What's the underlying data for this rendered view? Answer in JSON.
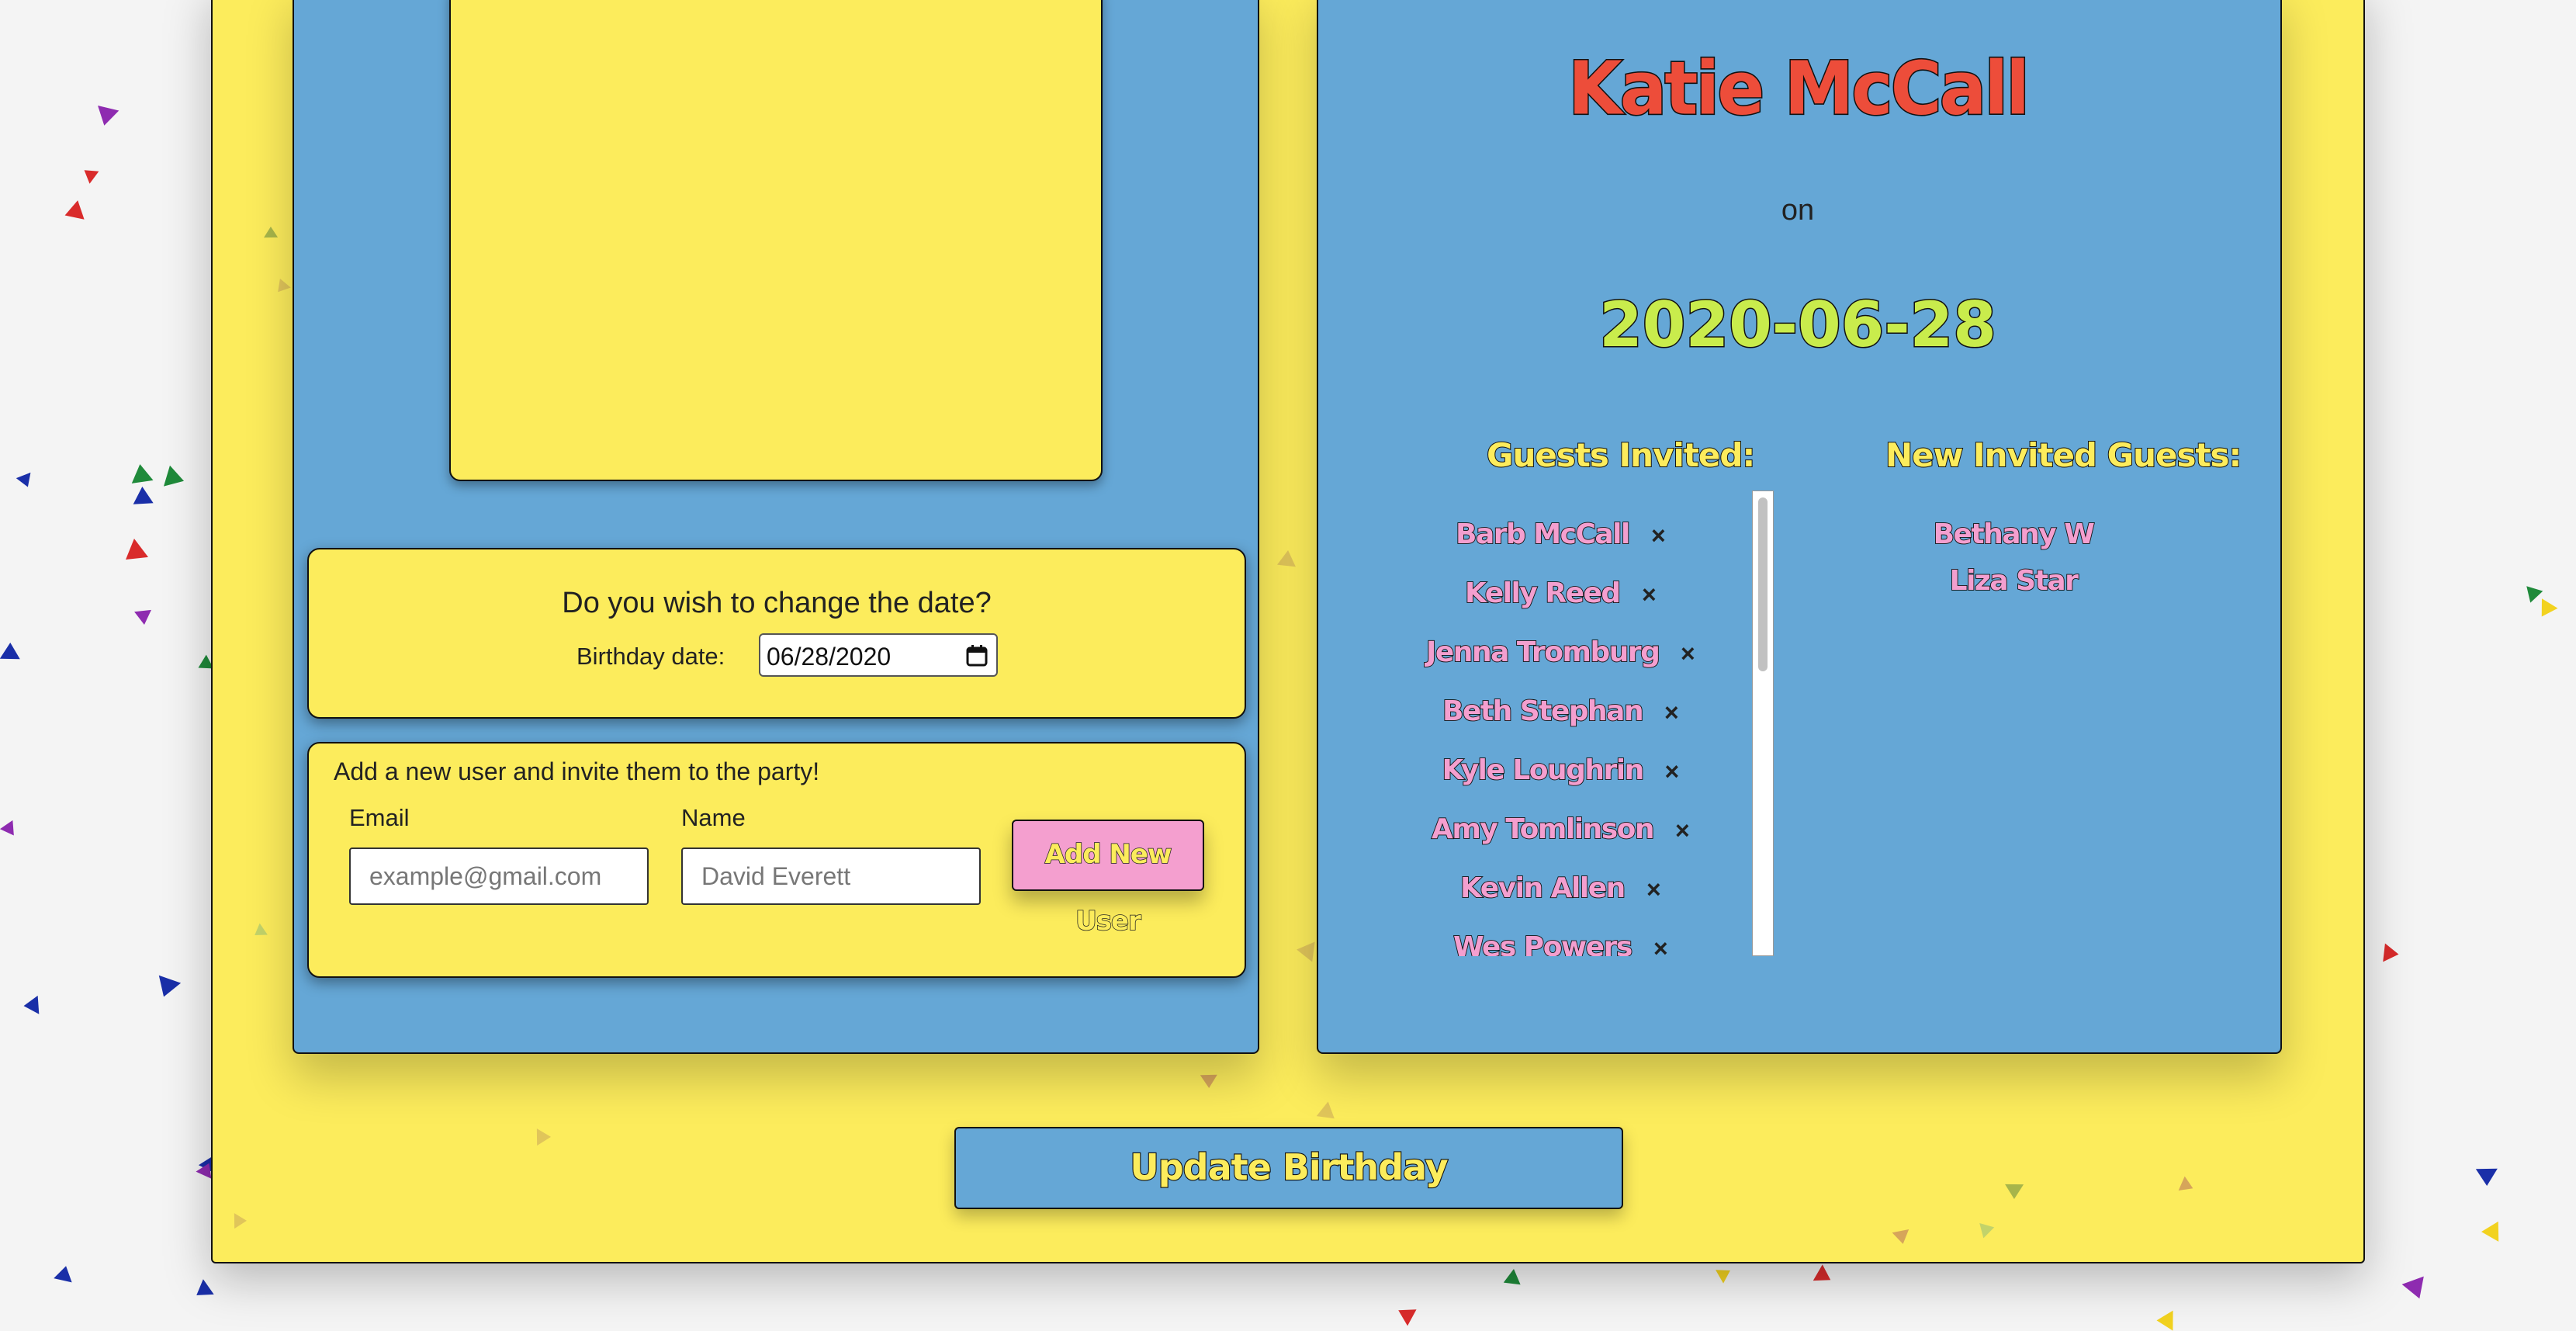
{
  "colors": {
    "page_bg": "#f4f4f4",
    "card_yellow": "#fcec5c",
    "panel_blue": "#65a7d6",
    "name_red": "#ed4d3a",
    "date_green": "#c9ec4c",
    "guest_pink": "#f49fcf"
  },
  "date_section": {
    "question": "Do you wish to change the date?",
    "label": "Birthday date:",
    "value": "06/28/2020",
    "icon": "calendar-icon"
  },
  "new_user_section": {
    "title": "Add a new user and invite them to the party!",
    "email_label": "Email",
    "email_placeholder": "example@gmail.com",
    "name_label": "Name",
    "name_placeholder": "David Everett",
    "add_button": "Add New User"
  },
  "party": {
    "honoree": "Katie McCall",
    "on_text": "on",
    "date": "2020-06-28"
  },
  "guests": {
    "heading": "Guests Invited:",
    "remove_icon": "×",
    "list": [
      "Barb McCall",
      "Kelly Reed",
      "Jenna Tromburg",
      "Beth Stephan",
      "Kyle Loughrin",
      "Amy Tomlinson",
      "Kevin Allen",
      "Wes Powers"
    ]
  },
  "new_guests": {
    "heading": "New Invited Guests:",
    "list": [
      "Bethany W",
      "Liza Star"
    ]
  },
  "update_button": "Update Birthday"
}
